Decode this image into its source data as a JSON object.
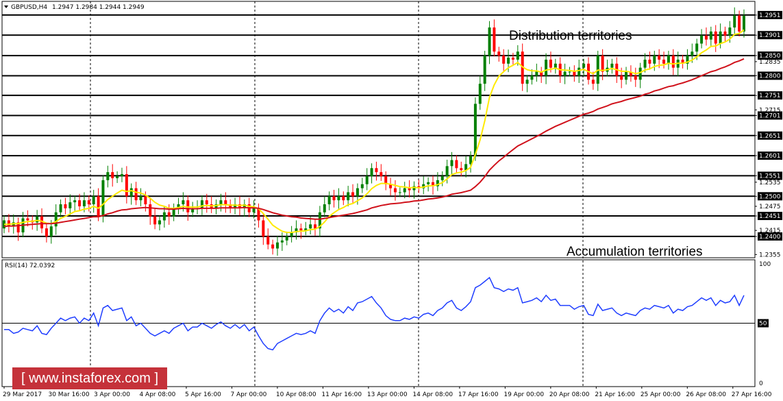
{
  "header": {
    "symbol": "GBPUSD,H4",
    "ohlc": "1.2947 1.2984 1.2944 1.2949"
  },
  "annotations": {
    "distribution": "Distribution territories",
    "accumulation": "Accumulation territories"
  },
  "watermark": "[  www.instaforex.com ]",
  "rsi_header": "RSI(14) 72.0392",
  "colors": {
    "bull_candle": "#008000",
    "bear_candle": "#ff0000",
    "fast_ma": "#ffea00",
    "slow_ma": "#d0111b",
    "rsi_line": "#1e3dff",
    "grid": "#000000",
    "watermark_bg": "#c5323a"
  },
  "chart_data": [
    {
      "type": "candlestick",
      "title": "GBPUSD,H4",
      "ylim": [
        1.2347,
        1.2985
      ],
      "price_ticks": [
        "1.2355",
        "1.2400",
        "1.2415",
        "1.2451",
        "1.2475",
        "1.2500",
        "1.2535",
        "1.2551",
        "1.2601",
        "1.2651",
        "1.2701",
        "1.2715",
        "1.2751",
        "1.2800",
        "1.2835",
        "1.2850",
        "1.2901",
        "1.2951"
      ],
      "horizontal_levels": [
        1.24,
        1.2451,
        1.25,
        1.2551,
        1.2601,
        1.2651,
        1.2701,
        1.2751,
        1.28,
        1.285,
        1.2901,
        1.2951
      ],
      "x_ticks": [
        "29 Mar 2017",
        "30 Mar 16:00",
        "3 Apr 00:00",
        "4 Apr 08:00",
        "5 Apr 16:00",
        "7 Apr 00:00",
        "10 Apr 08:00",
        "11 Apr 16:00",
        "13 Apr 00:00",
        "14 Apr 08:00",
        "17 Apr 16:00",
        "19 Apr 00:00",
        "20 Apr 08:00",
        "21 Apr 16:00",
        "25 Apr 00:00",
        "26 Apr 08:00",
        "27 Apr 16:00"
      ],
      "close": [
        1.244,
        1.2425,
        1.2435,
        1.241,
        1.2445,
        1.244,
        1.2435,
        1.245,
        1.242,
        1.24,
        1.2425,
        1.246,
        1.248,
        1.247,
        1.2485,
        1.249,
        1.2475,
        1.249,
        1.248,
        1.25,
        1.245,
        1.254,
        1.256,
        1.2545,
        1.255,
        1.2555,
        1.25,
        1.252,
        1.249,
        1.25,
        1.248,
        1.245,
        1.243,
        1.244,
        1.246,
        1.245,
        1.247,
        1.248,
        1.249,
        1.246,
        1.247,
        1.247,
        1.249,
        1.248,
        1.247,
        1.248,
        1.249,
        1.248,
        1.247,
        1.248,
        1.247,
        1.248,
        1.246,
        1.247,
        1.244,
        1.24,
        1.238,
        1.237,
        1.2385,
        1.239,
        1.24,
        1.241,
        1.242,
        1.2415,
        1.242,
        1.243,
        1.242,
        1.246,
        1.248,
        1.25,
        1.249,
        1.25,
        1.249,
        1.251,
        1.25,
        1.252,
        1.253,
        1.255,
        1.257,
        1.256,
        1.255,
        1.253,
        1.252,
        1.251,
        1.251,
        1.252,
        1.2515,
        1.2525,
        1.252,
        1.253,
        1.2535,
        1.2525,
        1.254,
        1.255,
        1.2575,
        1.259,
        1.257,
        1.2565,
        1.258,
        1.26,
        1.273,
        1.278,
        1.285,
        1.292,
        1.286,
        1.285,
        1.283,
        1.2845,
        1.284,
        1.286,
        1.278,
        1.279,
        1.28,
        1.281,
        1.28,
        1.284,
        1.282,
        1.283,
        1.28,
        1.281,
        1.281,
        1.28,
        1.282,
        1.283,
        1.279,
        1.278,
        1.285,
        1.281,
        1.282,
        1.283,
        1.28,
        1.279,
        1.281,
        1.28,
        1.279,
        1.282,
        1.284,
        1.283,
        1.285,
        1.284,
        1.283,
        1.285,
        1.282,
        1.284,
        1.283,
        1.285,
        1.286,
        1.288,
        1.29,
        1.289,
        1.291,
        1.288,
        1.291,
        1.29,
        1.292,
        1.295,
        1.291,
        1.2949
      ],
      "series": [
        {
          "name": "fast_ma",
          "values": [
            1.243,
            1.243,
            1.2432,
            1.2432,
            1.2435,
            1.2437,
            1.2438,
            1.244,
            1.2438,
            1.2433,
            1.2432,
            1.2437,
            1.2445,
            1.245,
            1.2456,
            1.2462,
            1.2464,
            1.2468,
            1.247,
            1.2475,
            1.247,
            1.248,
            1.2492,
            1.25,
            1.2508,
            1.2515,
            1.2512,
            1.2514,
            1.251,
            1.2508,
            1.2503,
            1.2495,
            1.2485,
            1.2478,
            1.2475,
            1.247,
            1.247,
            1.2472,
            1.2475,
            1.2473,
            1.2473,
            1.2473,
            1.2476,
            1.2477,
            1.2476,
            1.2477,
            1.2479,
            1.2479,
            1.2478,
            1.2478,
            1.2477,
            1.2478,
            1.2475,
            1.2474,
            1.2469,
            1.2457,
            1.2443,
            1.2428,
            1.242,
            1.2413,
            1.241,
            1.241,
            1.2412,
            1.2413,
            1.2414,
            1.2417,
            1.2418,
            1.2425,
            1.2436,
            1.245,
            1.2459,
            1.2467,
            1.2472,
            1.2479,
            1.2482,
            1.2489,
            1.2496,
            1.2506,
            1.2519,
            1.2527,
            1.2532,
            1.2532,
            1.253,
            1.2527,
            1.2524,
            1.2523,
            1.2521,
            1.2522,
            1.2521,
            1.2523,
            1.2526,
            1.2526,
            1.2529,
            1.2534,
            1.2543,
            1.2554,
            1.2558,
            1.256,
            1.2564,
            1.2572,
            1.2604,
            1.264,
            1.2688,
            1.2746,
            1.2777,
            1.2799,
            1.281,
            1.282,
            1.2826,
            1.2833,
            1.2822,
            1.2815,
            1.2812,
            1.2812,
            1.2809,
            1.2814,
            1.2816,
            1.2819,
            1.2815,
            1.2814,
            1.2813,
            1.2811,
            1.2813,
            1.2816,
            1.281,
            1.2805,
            1.2814,
            1.2813,
            1.2815,
            1.2818,
            1.2815,
            1.2811,
            1.2811,
            1.2809,
            1.2805,
            1.2808,
            1.2814,
            1.2817,
            1.2823,
            1.2826,
            1.2827,
            1.2831,
            1.2829,
            1.2831,
            1.2831,
            1.2834,
            1.2839,
            1.2847,
            1.2857,
            1.2864,
            1.2873,
            1.2874,
            1.288,
            1.2884,
            1.2891,
            1.2903,
            1.2905,
            1.2914
          ]
        },
        {
          "name": "slow_ma",
          "values": [
            1.2425,
            1.2426,
            1.2426,
            1.2427,
            1.2428,
            1.2429,
            1.243,
            1.2431,
            1.2432,
            1.2432,
            1.2432,
            1.2433,
            1.2435,
            1.2437,
            1.2439,
            1.2441,
            1.2443,
            1.2445,
            1.2447,
            1.2449,
            1.2449,
            1.2452,
            1.2456,
            1.2459,
            1.2463,
            1.2466,
            1.2467,
            1.2469,
            1.247,
            1.2471,
            1.2472,
            1.2471,
            1.247,
            1.2469,
            1.2469,
            1.2468,
            1.2468,
            1.2469,
            1.247,
            1.2469,
            1.2469,
            1.2469,
            1.247,
            1.247,
            1.247,
            1.247,
            1.2471,
            1.2471,
            1.2471,
            1.2471,
            1.2471,
            1.2472,
            1.2471,
            1.2471,
            1.247,
            1.2467,
            1.2463,
            1.2459,
            1.2456,
            1.2453,
            1.2451,
            1.2449,
            1.2448,
            1.2446,
            1.2445,
            1.2444,
            1.2443,
            1.2443,
            1.2445,
            1.2447,
            1.2449,
            1.2451,
            1.2453,
            1.2455,
            1.2457,
            1.246,
            1.2463,
            1.2466,
            1.2471,
            1.2474,
            1.2477,
            1.2479,
            1.2481,
            1.2482,
            1.2483,
            1.2485,
            1.2486,
            1.2488,
            1.2489,
            1.2491,
            1.2493,
            1.2494,
            1.2496,
            1.2498,
            1.2501,
            1.2505,
            1.2507,
            1.2509,
            1.2512,
            1.2515,
            1.2524,
            1.2535,
            1.2549,
            1.2565,
            1.2577,
            1.2588,
            1.2597,
            1.2607,
            1.2616,
            1.2625,
            1.2631,
            1.2637,
            1.2643,
            1.2649,
            1.2655,
            1.2662,
            1.2668,
            1.2674,
            1.2679,
            1.2684,
            1.2689,
            1.2694,
            1.2699,
            1.2704,
            1.2707,
            1.2711,
            1.2717,
            1.2721,
            1.2725,
            1.273,
            1.2733,
            1.2736,
            1.274,
            1.2743,
            1.2746,
            1.2749,
            1.2754,
            1.2757,
            1.2762,
            1.2765,
            1.2769,
            1.2773,
            1.2775,
            1.2779,
            1.2782,
            1.2786,
            1.279,
            1.2795,
            1.28,
            1.2805,
            1.281,
            1.2813,
            1.2818,
            1.2822,
            1.2827,
            1.2833,
            1.2837,
            1.2842
          ]
        }
      ]
    },
    {
      "type": "line",
      "title": "RSI(14) 72.0392",
      "ylim": [
        0,
        100
      ],
      "y_ticks": [
        "100",
        "50",
        "0"
      ],
      "level": 50,
      "series": [
        {
          "name": "RSI(14)",
          "values": [
            45,
            45,
            42,
            43,
            46,
            45,
            44,
            48,
            42,
            41,
            46,
            50,
            54,
            52,
            54,
            55,
            50,
            54,
            52,
            58,
            48,
            62,
            64,
            60,
            61,
            62,
            52,
            55,
            48,
            50,
            46,
            42,
            40,
            42,
            44,
            42,
            46,
            48,
            50,
            44,
            47,
            47,
            50,
            48,
            46,
            49,
            51,
            48,
            46,
            49,
            46,
            49,
            44,
            47,
            40,
            34,
            30,
            29,
            34,
            36,
            38,
            40,
            42,
            41,
            42,
            44,
            42,
            52,
            58,
            62,
            59,
            61,
            58,
            63,
            60,
            66,
            67,
            69,
            71,
            66,
            62,
            56,
            53,
            52,
            52,
            54,
            53,
            55,
            54,
            57,
            58,
            56,
            60,
            62,
            66,
            68,
            62,
            60,
            63,
            67,
            78,
            80,
            83,
            86,
            78,
            77,
            75,
            77,
            76,
            78,
            66,
            67,
            68,
            70,
            67,
            72,
            68,
            69,
            64,
            64,
            64,
            61,
            63,
            64,
            57,
            56,
            65,
            60,
            61,
            62,
            58,
            56,
            58,
            57,
            56,
            60,
            62,
            61,
            64,
            63,
            62,
            64,
            58,
            61,
            60,
            63,
            64,
            67,
            70,
            68,
            70,
            64,
            68,
            66,
            67,
            72,
            64,
            72
          ]
        }
      ]
    }
  ]
}
